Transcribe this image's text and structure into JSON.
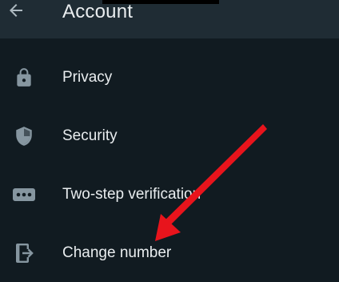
{
  "header": {
    "back_icon": "arrow-left-icon",
    "title": "Account"
  },
  "menu": {
    "items": [
      {
        "label": "Privacy",
        "icon": "lock-icon"
      },
      {
        "label": "Security",
        "icon": "shield-icon"
      },
      {
        "label": "Two-step verification",
        "icon": "dots-pin-icon"
      },
      {
        "label": "Change number",
        "icon": "change-number-icon"
      }
    ]
  },
  "annotation": {
    "type": "arrow",
    "color": "#e8141c",
    "points_to": "Change number"
  },
  "colors": {
    "background": "#111b21",
    "appbar": "#1f2c34",
    "text": "#e9edef",
    "icon": "#8696a0"
  }
}
